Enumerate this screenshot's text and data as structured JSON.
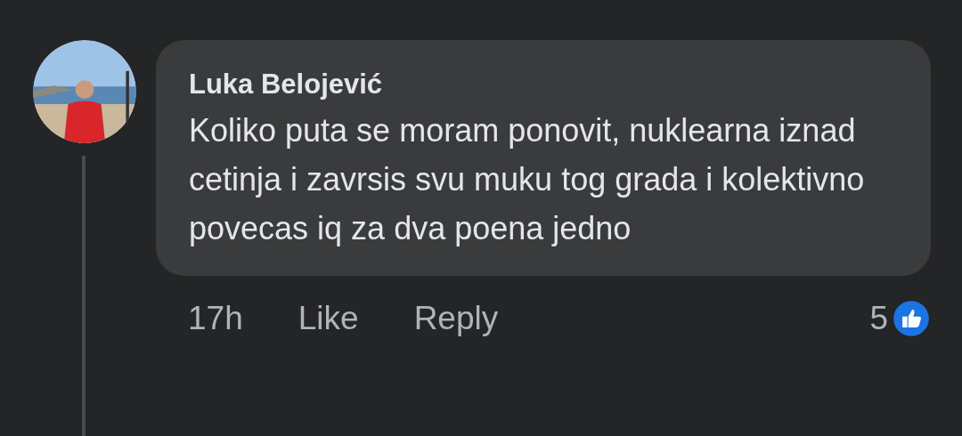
{
  "comment": {
    "author": "Luka Belojević",
    "text": "Koliko puta se moram ponovit, nuklearna iznad cetinja i zavrsis svu muku tog grada i kolektivno povecas iq za dva poena jedno",
    "time": "17h",
    "actions": [
      "Like",
      "Reply"
    ],
    "reaction_count": "5"
  }
}
